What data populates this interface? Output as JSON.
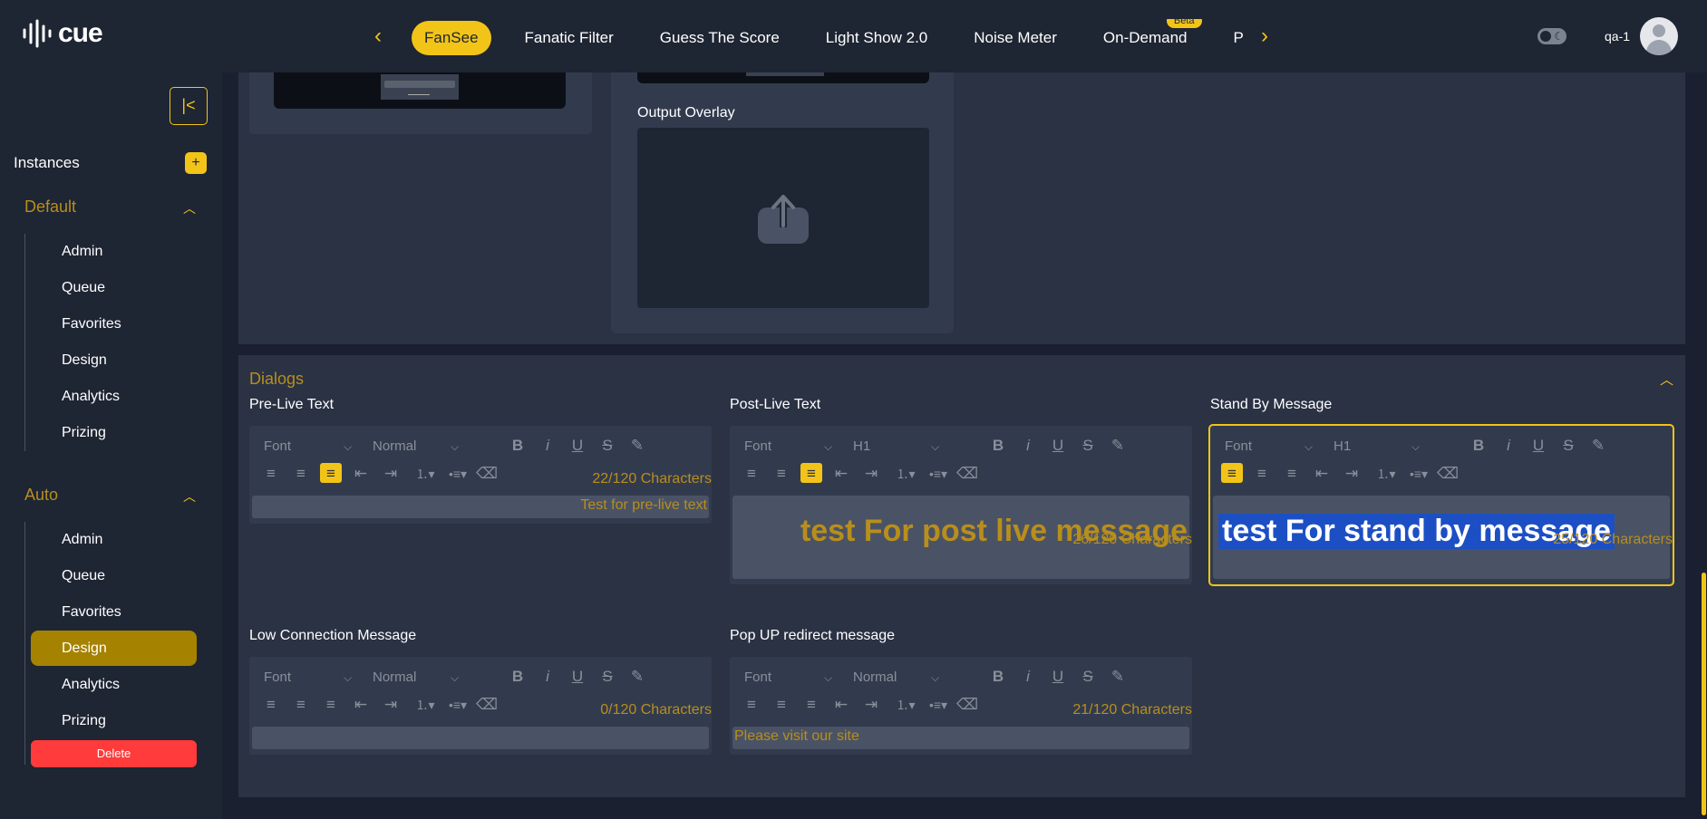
{
  "app": {
    "logo_text": "cue"
  },
  "nav": {
    "tabs": [
      {
        "label": "FanSee",
        "active": true
      },
      {
        "label": "Fanatic Filter"
      },
      {
        "label": "Guess The Score"
      },
      {
        "label": "Light Show 2.0"
      },
      {
        "label": "Noise Meter"
      },
      {
        "label": "On-Demand",
        "badge": "Beta"
      },
      {
        "label": "P"
      }
    ]
  },
  "header": {
    "user_name": "qa-1"
  },
  "sidebar": {
    "collapse_icon": "|<",
    "instances_label": "Instances",
    "add_label": "+",
    "groups": [
      {
        "title": "Default",
        "items": [
          "Admin",
          "Queue",
          "Favorites",
          "Design",
          "Analytics",
          "Prizing"
        ]
      },
      {
        "title": "Auto",
        "items": [
          "Admin",
          "Queue",
          "Favorites",
          "Design",
          "Analytics",
          "Prizing"
        ],
        "active_item": "Design"
      }
    ],
    "delete_label": "Delete"
  },
  "design": {
    "output_overlay_label": "Output Overlay"
  },
  "dialogs": {
    "title": "Dialogs",
    "fields": [
      {
        "label": "Pre-Live Text",
        "font": "Font",
        "size": "Normal",
        "text": "Test for pre-live text",
        "count": "22/120 Characters"
      },
      {
        "label": "Post-Live Text",
        "font": "Font",
        "size": "H1",
        "text": "test For post live message",
        "count": "26/120 Characters"
      },
      {
        "label": "Stand By Message",
        "font": "Font",
        "size": "H1",
        "text": "test For stand by message",
        "count": "25/120 Characters"
      },
      {
        "label": "Low Connection Message",
        "font": "Font",
        "size": "Normal",
        "text": "",
        "count": "0/120 Characters"
      },
      {
        "label": "Pop UP redirect message",
        "font": "Font",
        "size": "Normal",
        "text": "Please visit our site",
        "count": "21/120 Characters"
      }
    ]
  },
  "colors": {
    "accent": "#f2c418",
    "accent_dark": "#b88e1c",
    "active_item": "#a58200",
    "danger": "#ff3b3b",
    "selection": "#1d4fc4"
  }
}
